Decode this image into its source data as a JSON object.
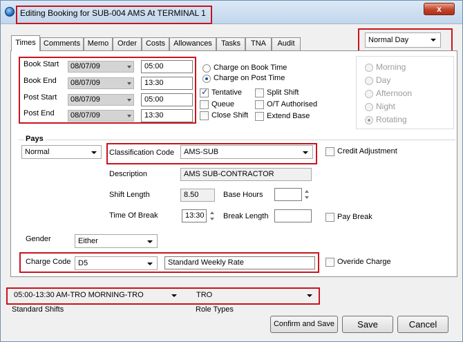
{
  "window": {
    "title": "Editing Booking for SUB-004 AMS At TERMINAL 1",
    "close_glyph": "x"
  },
  "day_type": "Normal Day",
  "tabs": [
    "Times",
    "Comments",
    "Memo",
    "Order",
    "Costs",
    "Allowances",
    "Tasks",
    "TNA",
    "Audit"
  ],
  "times": {
    "rows": [
      {
        "label": "Book Start",
        "date": "08/07/09",
        "time": "05:00"
      },
      {
        "label": "Book End",
        "date": "08/07/09",
        "time": "13:30"
      },
      {
        "label": "Post Start",
        "date": "08/07/09",
        "time": "05:00"
      },
      {
        "label": "Post End",
        "date": "08/07/09",
        "time": "13:30"
      }
    ],
    "charge_book": "Charge on Book Time",
    "charge_post": "Charge on Post Time",
    "tentative": "Tentative",
    "queue": "Queue",
    "close_shift": "Close Shift",
    "split_shift": "Split Shift",
    "ot_authorised": "O/T Authorised",
    "extend_base": "Extend Base",
    "shift_periods": [
      "Morning",
      "Day",
      "Afternoon",
      "Night",
      "Rotating"
    ]
  },
  "pays": {
    "legend": "Pays",
    "pay_type": "Normal",
    "classification_label": "Classification Code",
    "classification_value": "AMS-SUB",
    "credit_adjustment": "Credit Adjustment",
    "description_label": "Description",
    "description_value": "AMS SUB-CONTRACTOR",
    "shift_length_label": "Shift Length",
    "shift_length_value": "8.50",
    "base_hours_label": "Base Hours",
    "base_hours_value": "",
    "time_of_break_label": "Time Of Break",
    "time_of_break_value": "13:30",
    "break_length_label": "Break Length",
    "break_length_value": "",
    "pay_break": "Pay Break",
    "gender_label": "Gender",
    "gender_value": "Either",
    "charge_code_label": "Charge Code",
    "charge_code_value": "D5",
    "charge_code_desc": "Standard Weekly Rate",
    "override_charge": "Overide Charge"
  },
  "standard_shifts": {
    "value": "05:00-13:30 AM-TRO MORNING-TRO",
    "label": "Standard Shifts"
  },
  "role_types": {
    "value": "TRO",
    "label": "Role Types"
  },
  "buttons": {
    "confirm_save": "Confirm and Save",
    "save": "Save",
    "cancel": "Cancel"
  }
}
